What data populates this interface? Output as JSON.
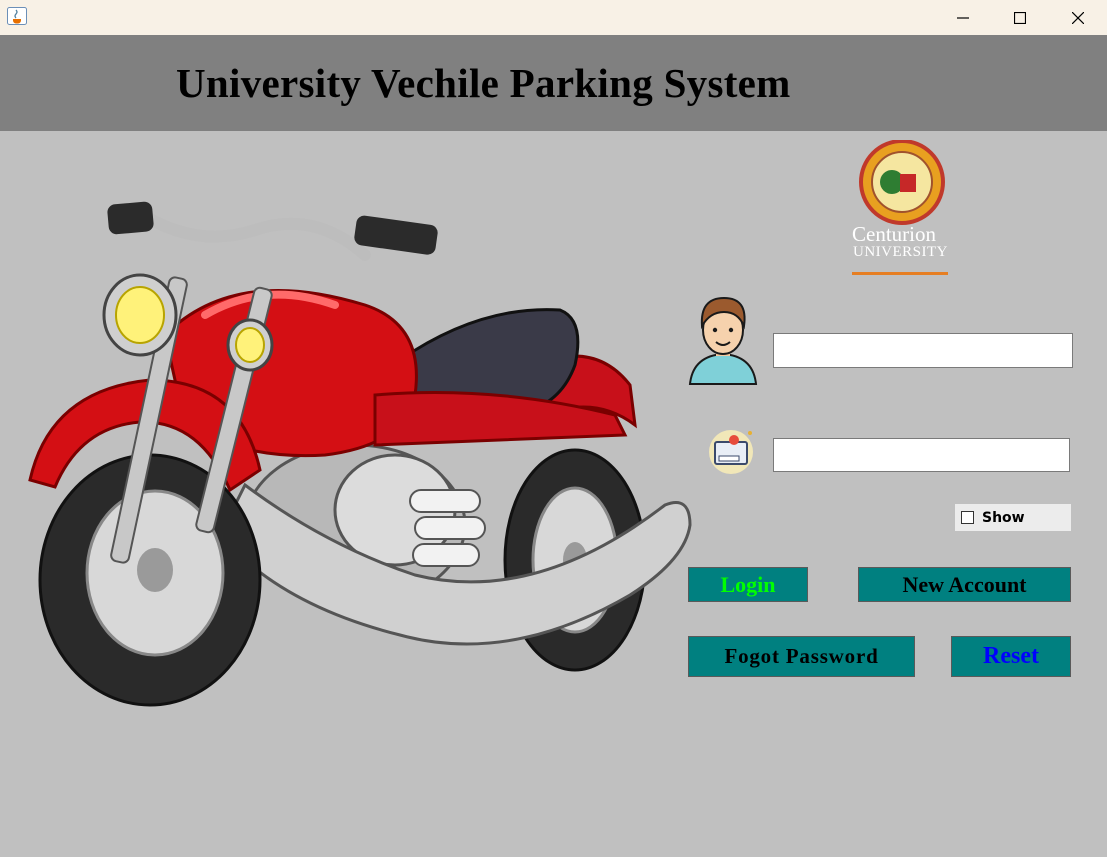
{
  "window": {
    "app_icon": "java-icon",
    "controls": [
      "minimize-icon",
      "maximize-icon",
      "close-icon"
    ]
  },
  "header": {
    "title": "University Vechile Parking System"
  },
  "logo": {
    "line1": "Centurion",
    "line2": "UNIVERSITY"
  },
  "form": {
    "username_value": "",
    "password_value": "",
    "show_label": "Show",
    "show_checked": false
  },
  "buttons": {
    "login": "Login",
    "new_account": "New Account",
    "forgot_password": "Fogot Password",
    "reset": "Reset"
  },
  "colors": {
    "button_bg": "#008080",
    "login_text": "#00ff00",
    "reset_text": "#0000ff",
    "header_bg": "#808080",
    "body_bg": "#c0c0c0"
  }
}
